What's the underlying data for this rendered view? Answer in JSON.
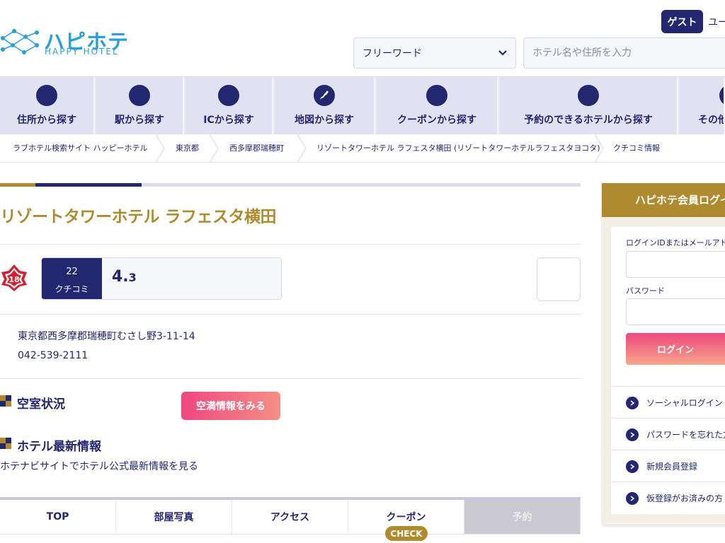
{
  "header": {
    "logo_jp": "ハピホテ",
    "logo_en": "HAPPY HOTEL",
    "guest_label": "ゲスト",
    "user_text": "ユー",
    "select_value": "フリーワード",
    "search_placeholder": "ホテル名や住所を入力"
  },
  "nav": {
    "items": [
      {
        "label": "住所から探す"
      },
      {
        "label": "駅から探す"
      },
      {
        "label": "ICから探す"
      },
      {
        "label": "地図から探す"
      },
      {
        "label": "クーポンから探す"
      },
      {
        "label": "予約のできるホテルから探す"
      },
      {
        "label": "その他"
      }
    ]
  },
  "breadcrumb": [
    "ラブホテル検索サイト ハッピーホテル",
    "東京都",
    "西多摩郡瑞穂町",
    "リゾートタワーホテル ラフェスタ横田 (リゾートタワーホテルラフェスタヨコタ)",
    "クチコミ情報"
  ],
  "hotel": {
    "name": "リゾートタワーホテル ラフェスタ横田",
    "review_count": "22",
    "review_label": "クチコミ",
    "rating_int": "4.",
    "rating_dec": "3",
    "age_label": "18",
    "address": "東京都西多摩郡瑞穂町むさし野3-11-14",
    "phone": "042-539-2111"
  },
  "sections": {
    "vacancy_title": "空室状況",
    "vacancy_button": "空満情報をみる",
    "latest_title": "ホテル最新情報",
    "latest_text": "ホテナビサイトでホテル公式最新情報を見る"
  },
  "tabs": [
    {
      "label": "TOP"
    },
    {
      "label": "部屋写真"
    },
    {
      "label": "アクセス"
    },
    {
      "label": "クーポン"
    },
    {
      "label": "予約"
    }
  ],
  "check_badge": "CHECK",
  "login": {
    "title": "ハピホテ会員ログイン",
    "id_label": "ログインIDまたはメールアドレス",
    "password_label": "パスワード",
    "login_button": "ログイン",
    "links": [
      "ソーシャルログイン",
      "パスワードを忘れた方",
      "新規会員登録",
      "仮登録がお済みの方"
    ]
  },
  "colors": {
    "navy": "#232770",
    "gold": "#b08a2e",
    "pink": "#f0477f",
    "logo_blue": "#2b9fd9"
  }
}
